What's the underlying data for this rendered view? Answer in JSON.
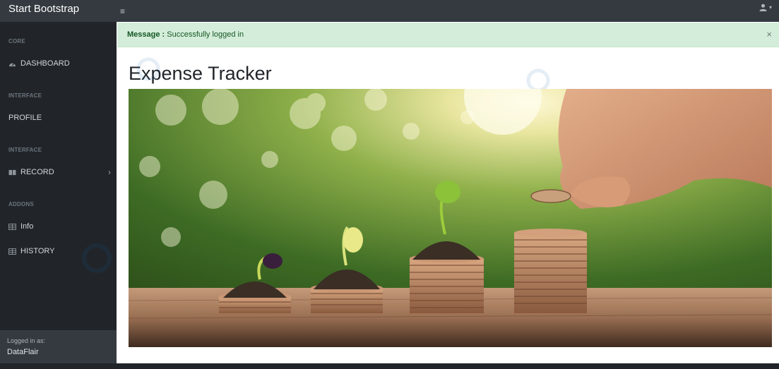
{
  "navbar": {
    "brand": "Start Bootstrap",
    "toggle_icon": "hamburger-icon",
    "user_icon": "user-icon",
    "caret": "▾"
  },
  "sidebar": {
    "headings": [
      "CORE",
      "INTERFACE",
      "INTERFACE",
      "ADDONS"
    ],
    "items": [
      {
        "label": "DASHBOARD",
        "icon": "dashboard-icon"
      },
      {
        "label": "PROFILE",
        "icon": ""
      },
      {
        "label": "RECORD",
        "icon": "book-icon",
        "expandable": true
      },
      {
        "label": "Info",
        "icon": "table-icon"
      },
      {
        "label": "HISTORY",
        "icon": "table-icon"
      }
    ],
    "footer": {
      "label": "Logged in as:",
      "user": "DataFlair"
    }
  },
  "alert": {
    "label": "Message :",
    "text": "Successfully logged in",
    "close": "×"
  },
  "main": {
    "title": "Expense Tracker",
    "hero_alt": "Hand placing coins on growing stacks of coins with seedlings"
  },
  "colors": {
    "navbar": "#343a40",
    "sidebar": "#212529",
    "alert_bg": "#d4edda",
    "alert_text": "#155724"
  }
}
